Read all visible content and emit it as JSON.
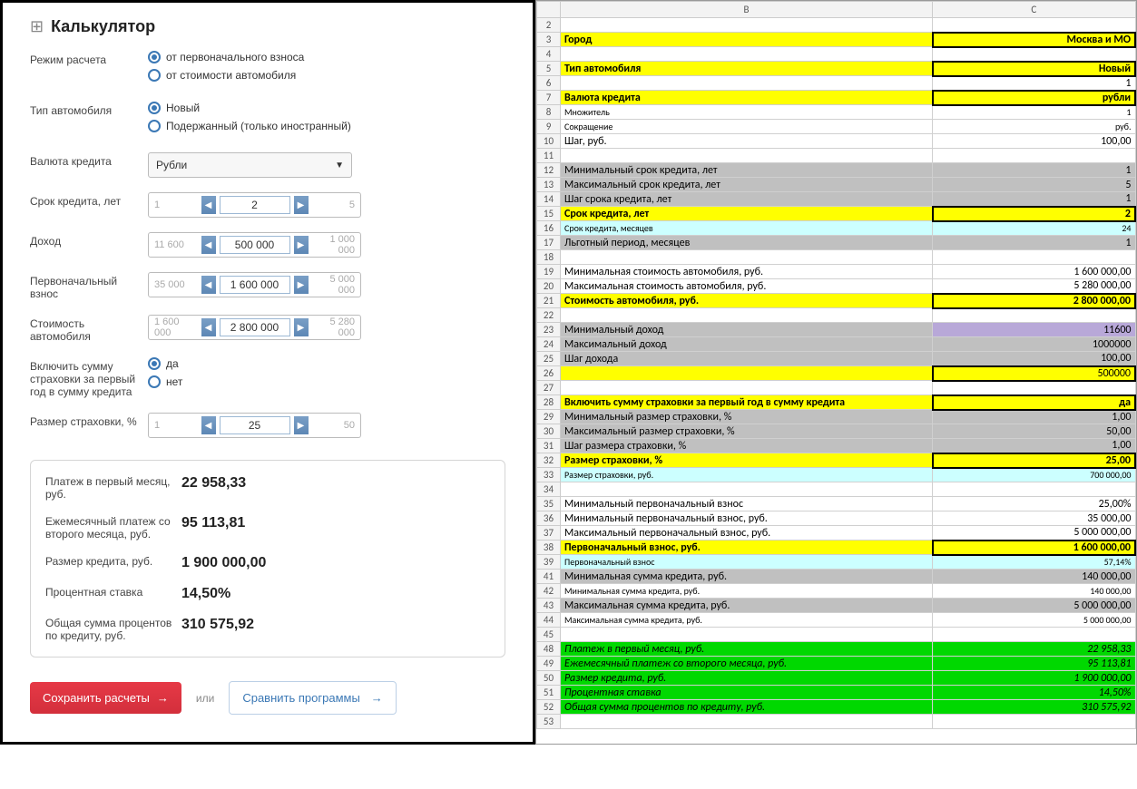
{
  "calculator": {
    "title": "Калькулятор",
    "mode_label": "Режим расчета",
    "mode_options": [
      "от первоначального взноса",
      "от стоимости автомобиля"
    ],
    "mode_selected": 0,
    "type_label": "Тип автомобиля",
    "type_options": [
      "Новый",
      "Подержанный (только иностранный)"
    ],
    "type_selected": 0,
    "currency_label": "Валюта кредита",
    "currency_value": "Рубли",
    "term_label": "Срок кредита, лет",
    "term": {
      "min": "1",
      "value": "2",
      "max": "5"
    },
    "income_label": "Доход",
    "income": {
      "min": "11 600",
      "value": "500 000",
      "max": "1 000 000"
    },
    "downpay_label": "Первоначальный взнос",
    "downpay": {
      "min": "35 000",
      "value": "1 600 000",
      "max": "5 000 000"
    },
    "cost_label": "Стоимость автомобиля",
    "cost": {
      "min": "1 600 000",
      "value": "2 800 000",
      "max": "5 280 000"
    },
    "insurance_include_label": "Включить сумму страховки за первый год в сумму кредита",
    "insurance_options": [
      "да",
      "нет"
    ],
    "insurance_selected": 0,
    "insurance_rate_label": "Размер страховки, %",
    "insurance_rate": {
      "min": "1",
      "value": "25",
      "max": "50"
    },
    "results": [
      {
        "label": "Платеж в первый месяц, руб.",
        "value": "22 958,33"
      },
      {
        "label": "Ежемесячный платеж со второго месяца, руб.",
        "value": "95 113,81"
      },
      {
        "label": "Размер кредита, руб.",
        "value": "1 900 000,00"
      },
      {
        "label": "Процентная ставка",
        "value": "14,50%"
      },
      {
        "label": "Общая сумма процентов по кредиту, руб.",
        "value": "310 575,92"
      }
    ],
    "save_button": "Сохранить расчеты",
    "or_text": "или",
    "compare_button": "Сравнить программы"
  },
  "sheet": {
    "col_b_header": "B",
    "col_c_header": "C",
    "rows": [
      {
        "n": "2",
        "b": "",
        "c": "",
        "cls": ""
      },
      {
        "n": "3",
        "b": "Город",
        "c": "Москва и МО",
        "cls": "bg-yellow bold",
        "cbox": true
      },
      {
        "n": "4",
        "b": "",
        "c": "",
        "cls": ""
      },
      {
        "n": "5",
        "b": "Тип автомобиля",
        "c": "Новый",
        "cls": "bg-yellow bold",
        "cbox": true
      },
      {
        "n": "6",
        "b": "",
        "c": "1",
        "cls": ""
      },
      {
        "n": "7",
        "b": "Валюта кредита",
        "c": "рубли",
        "cls": "bg-yellow bold",
        "cbox": true
      },
      {
        "n": "8",
        "b": "Множитель",
        "c": "1",
        "cls": "smallfont"
      },
      {
        "n": "9",
        "b": "Сокращение",
        "c": "руб.",
        "cls": "smallfont"
      },
      {
        "n": "10",
        "b": "Шаг, руб.",
        "c": "100,00",
        "cls": ""
      },
      {
        "n": "11",
        "b": "",
        "c": "",
        "cls": ""
      },
      {
        "n": "12",
        "b": "Минимальный срок кредита, лет",
        "c": "1",
        "cls": "bg-gray"
      },
      {
        "n": "13",
        "b": "Максимальный срок кредита, лет",
        "c": "5",
        "cls": "bg-gray"
      },
      {
        "n": "14",
        "b": "Шаг срока кредита, лет",
        "c": "1",
        "cls": "bg-gray"
      },
      {
        "n": "15",
        "b": "Срок кредита, лет",
        "c": "2",
        "cls": "bg-yellow bold",
        "cbox": true
      },
      {
        "n": "16",
        "b": "Срок кредита, месяцев",
        "c": "24",
        "cls": "bg-cyan smallfont"
      },
      {
        "n": "17",
        "b": "Льготный период, месяцев",
        "c": "1",
        "cls": "bg-gray"
      },
      {
        "n": "18",
        "b": "",
        "c": "",
        "cls": ""
      },
      {
        "n": "19",
        "b": "Минимальная стоимость автомобиля, руб.",
        "c": "1 600 000,00",
        "cls": ""
      },
      {
        "n": "20",
        "b": "Максимальная стоимость автомобиля, руб.",
        "c": "5 280 000,00",
        "cls": ""
      },
      {
        "n": "21",
        "b": "Стоимость автомобиля, руб.",
        "c": "2 800 000,00",
        "cls": "bg-yellow bold",
        "cbox": true
      },
      {
        "n": "22",
        "b": "",
        "c": "",
        "cls": ""
      },
      {
        "n": "23",
        "b": "Минимальный доход",
        "c": "11600",
        "cls": "bg-gray",
        "ccls": "bg-purple"
      },
      {
        "n": "24",
        "b": "Максимальный доход",
        "c": "1000000",
        "cls": "bg-gray"
      },
      {
        "n": "25",
        "b": "Шаг дохода",
        "c": "100,00",
        "cls": "bg-gray"
      },
      {
        "n": "26",
        "b": "",
        "c": "500000",
        "cls": "bg-yellow",
        "cbox": true
      },
      {
        "n": "27",
        "b": "",
        "c": "",
        "cls": ""
      },
      {
        "n": "28",
        "b": "Включить сумму страховки за первый год в сумму кредита",
        "c": "да",
        "cls": "bg-yellow bold",
        "cbox": true
      },
      {
        "n": "29",
        "b": "Минимальный размер страховки, %",
        "c": "1,00",
        "cls": "bg-gray"
      },
      {
        "n": "30",
        "b": "Максимальный размер страховки, %",
        "c": "50,00",
        "cls": "bg-gray"
      },
      {
        "n": "31",
        "b": "Шаг размера страховки, %",
        "c": "1,00",
        "cls": "bg-gray"
      },
      {
        "n": "32",
        "b": "Размер страховки, %",
        "c": "25,00",
        "cls": "bg-yellow bold",
        "cbox": true
      },
      {
        "n": "33",
        "b": "Размер страховки, руб.",
        "c": "700 000,00",
        "cls": "bg-cyan smallfont"
      },
      {
        "n": "34",
        "b": "",
        "c": "",
        "cls": ""
      },
      {
        "n": "35",
        "b": "Минимальный первоначальный взнос",
        "c": "25,00%",
        "cls": ""
      },
      {
        "n": "36",
        "b": "Минимальный первоначальный взнос, руб.",
        "c": "35 000,00",
        "cls": ""
      },
      {
        "n": "37",
        "b": "Максимальный первоначальный взнос, руб.",
        "c": "5 000 000,00",
        "cls": ""
      },
      {
        "n": "38",
        "b": "Первоначальный взнос, руб.",
        "c": "1 600 000,00",
        "cls": "bg-yellow bold",
        "cbox": true
      },
      {
        "n": "39",
        "b": "Первоначальный взнос",
        "c": "57,14%",
        "cls": "bg-cyan smallfont"
      },
      {
        "n": "41",
        "b": "Минимальная сумма кредита, руб.",
        "c": "140 000,00",
        "cls": "bg-gray"
      },
      {
        "n": "42",
        "b": "Минимальная сумма кредита, руб.",
        "c": "140 000,00",
        "cls": "smallfont"
      },
      {
        "n": "43",
        "b": "Максимальная сумма кредита, руб.",
        "c": "5 000 000,00",
        "cls": "bg-gray"
      },
      {
        "n": "44",
        "b": "Максимальная сумма кредита, руб.",
        "c": "5 000 000,00",
        "cls": "smallfont"
      },
      {
        "n": "45",
        "b": "",
        "c": "",
        "cls": ""
      },
      {
        "n": "48",
        "b": "Платеж в первый месяц, руб.",
        "c": "22 958,33",
        "cls": "bg-green italic"
      },
      {
        "n": "49",
        "b": "Ежемесячный платеж со второго месяца, руб.",
        "c": "95 113,81",
        "cls": "bg-green italic"
      },
      {
        "n": "50",
        "b": "Размер кредита, руб.",
        "c": "1 900 000,00",
        "cls": "bg-green italic"
      },
      {
        "n": "51",
        "b": "Процентная ставка",
        "c": "14,50%",
        "cls": "bg-green italic"
      },
      {
        "n": "52",
        "b": "Общая сумма процентов по кредиту, руб.",
        "c": "310 575,92",
        "cls": "bg-green italic"
      },
      {
        "n": "53",
        "b": "",
        "c": "",
        "cls": ""
      }
    ]
  }
}
